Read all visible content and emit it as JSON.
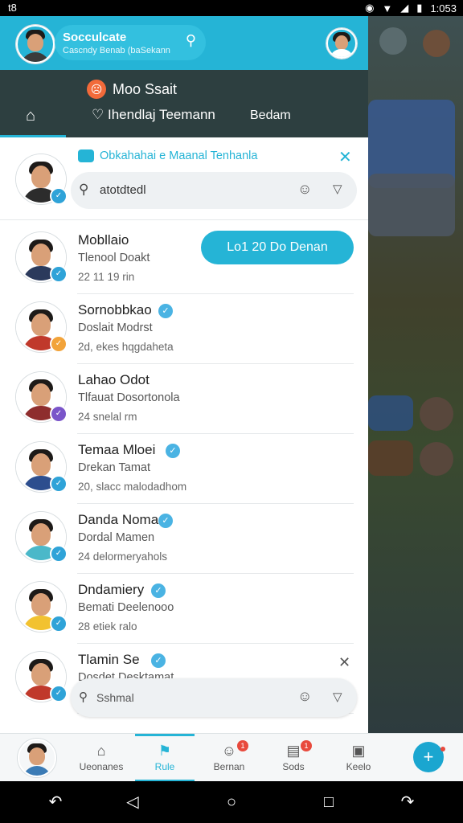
{
  "status_bar": {
    "left_text": "t8",
    "time": "1:053"
  },
  "header": {
    "search_title": "Socculcate",
    "search_subtitle": "Cascndy Benab (baSekann",
    "search_icon": "search-icon"
  },
  "promo": {
    "icon": "emoji-icon",
    "title": "Moo Ssait"
  },
  "tabs": [
    {
      "label": "",
      "icon": "home-icon"
    },
    {
      "label": "Ihendlaj Teemann",
      "icon": "heart-icon"
    },
    {
      "label": "Bedam",
      "icon": ""
    }
  ],
  "search_card": {
    "title": "Obkahahai e Maanal Tenhanla",
    "query": "atotdtedl"
  },
  "contacts": [
    {
      "name": "Mobllaio",
      "sub": "Tlenool Doakt",
      "meta": "22 11 19 rin",
      "badge_color": "#2fa3d8",
      "action_label": "Lo1 20 Do Denan"
    },
    {
      "name": "Sornobbkao",
      "sub": "Doslait Modrst",
      "meta": "2d, ekes hqgdaheta",
      "badge_color": "#f2a33a"
    },
    {
      "name": "Lahao Odot",
      "sub": "Tlfauat Dosortonola",
      "meta": "24 snelal rm",
      "badge_color": "#7a55c9"
    },
    {
      "name": "Temaa Mloei",
      "sub": "Drekan Tamat",
      "meta": "20, slacc malodadhom",
      "badge_color": "#2fa3d8"
    },
    {
      "name": "Danda Noma",
      "sub": "Dordal Mamen",
      "meta": "24 delormeryahols",
      "badge_color": "#2fa3d8"
    },
    {
      "name": "Dndamiery",
      "sub": "Bemati Deelenooo",
      "meta": "28 etiek ralo",
      "badge_color": "#2fa3d8"
    },
    {
      "name": "Tlamin Se",
      "sub": "Dosdet Desktamat",
      "meta": "",
      "badge_color": "#2fa3d8"
    }
  ],
  "inline_search": {
    "placeholder": "Sshmal"
  },
  "bottom_nav": [
    {
      "label": "",
      "icon": "avatar"
    },
    {
      "label": "Ueonanes",
      "icon": "home-icon"
    },
    {
      "label": "Rule",
      "icon": "flag-icon"
    },
    {
      "label": "Bernan",
      "icon": "face-icon",
      "count": "1"
    },
    {
      "label": "Sods",
      "icon": "stack-icon",
      "count": "1"
    },
    {
      "label": "Keelo",
      "icon": "card-icon"
    }
  ],
  "colors": {
    "accent": "#25b4d6",
    "dark": "#2d3f40",
    "fab": "#1aa6d0"
  }
}
